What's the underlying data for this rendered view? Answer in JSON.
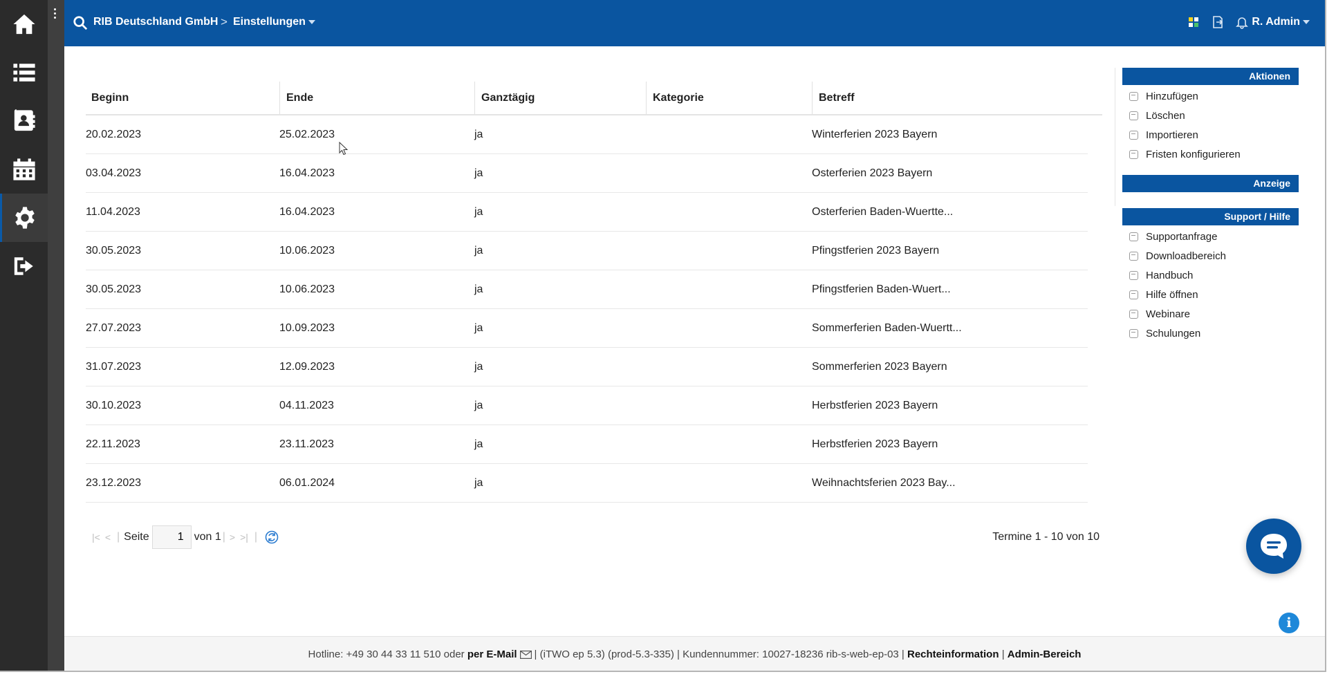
{
  "sidebar": {
    "items": [
      {
        "icon": "home-icon"
      },
      {
        "icon": "list-icon"
      },
      {
        "icon": "contacts-icon"
      },
      {
        "icon": "calendar-icon"
      },
      {
        "icon": "gear-icon",
        "active": true
      },
      {
        "icon": "logout-icon"
      }
    ]
  },
  "header": {
    "company": "RIB Deutschland GmbH",
    "separator": ">",
    "section": "Einstellungen",
    "user": "R. Admin"
  },
  "table": {
    "columns": [
      "Beginn",
      "Ende",
      "Ganztägig",
      "Kategorie",
      "Betreff"
    ],
    "rows": [
      [
        "20.02.2023",
        "25.02.2023",
        "ja",
        "",
        "Winterferien 2023 Bayern"
      ],
      [
        "03.04.2023",
        "16.04.2023",
        "ja",
        "",
        "Osterferien 2023 Bayern"
      ],
      [
        "11.04.2023",
        "16.04.2023",
        "ja",
        "",
        "Osterferien Baden-Wuertte..."
      ],
      [
        "30.05.2023",
        "10.06.2023",
        "ja",
        "",
        "Pfingstferien 2023 Bayern"
      ],
      [
        "30.05.2023",
        "10.06.2023",
        "ja",
        "",
        "Pfingstferien Baden-Wuert..."
      ],
      [
        "27.07.2023",
        "10.09.2023",
        "ja",
        "",
        "Sommerferien Baden-Wuertt..."
      ],
      [
        "31.07.2023",
        "12.09.2023",
        "ja",
        "",
        "Sommerferien 2023 Bayern"
      ],
      [
        "30.10.2023",
        "04.11.2023",
        "ja",
        "",
        "Herbstferien 2023 Bayern"
      ],
      [
        "22.11.2023",
        "23.11.2023",
        "ja",
        "",
        "Herbstferien 2023 Bayern"
      ],
      [
        "23.12.2023",
        "06.01.2024",
        "ja",
        "",
        "Weihnachtsferien 2023 Bay..."
      ]
    ]
  },
  "pager": {
    "page_label": "Seite",
    "page_value": "1",
    "of_label": "von 1",
    "range": "Termine 1 - 10 von 10"
  },
  "panel": {
    "actions_title": "Aktionen",
    "actions": [
      "Hinzufügen",
      "Löschen",
      "Importieren",
      "Fristen konfigurieren"
    ],
    "display_title": "Anzeige",
    "support_title": "Support / Hilfe",
    "support": [
      "Supportanfrage",
      "Downloadbereich",
      "Handbuch",
      "Hilfe öffnen",
      "Webinare",
      "Schulungen"
    ]
  },
  "footer": {
    "hotline": "Hotline: +49 30 44 33 11 510 oder",
    "email_link": "per E-Mail",
    "version": "| (iTWO ep 5.3) (prod-5.3-335)  |  Kundennummer: 10027-18236 rib-s-web-ep-03 |",
    "legal_link": "Rechteinformation",
    "divider": "|",
    "admin_link": "Admin-Bereich"
  },
  "colors": {
    "brand": "#0a55a0",
    "sidebar": "#2b2b2b"
  },
  "info_glyph": "i"
}
